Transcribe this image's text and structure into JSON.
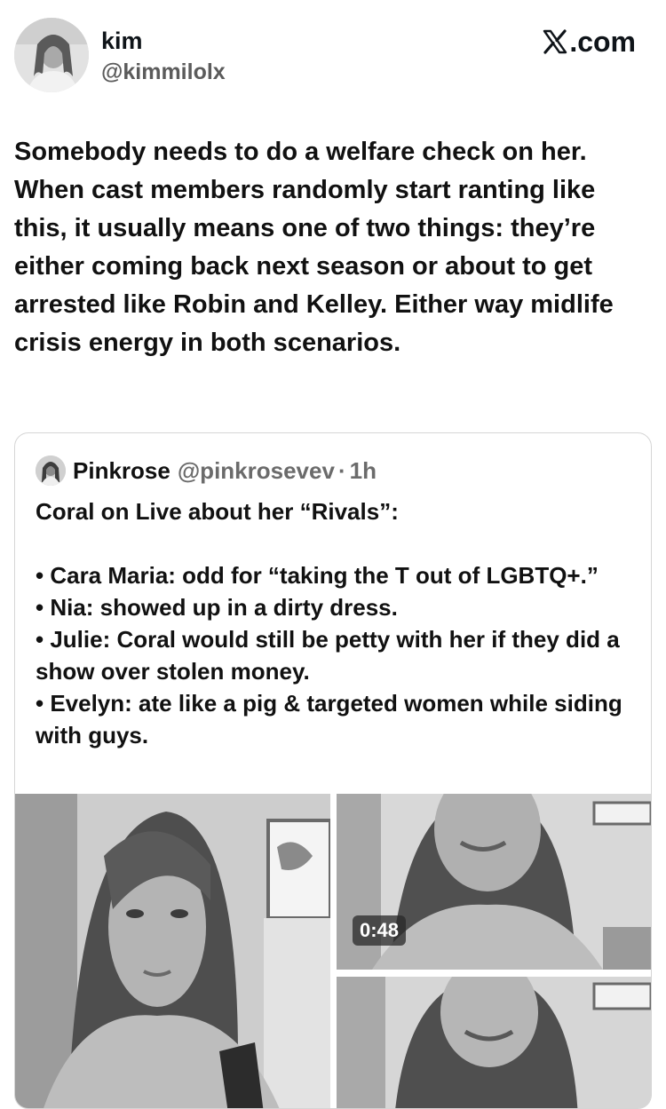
{
  "post": {
    "display_name": "kim",
    "handle": "@kimmilolx",
    "source": ".com",
    "text": "Somebody needs to do a welfare check on her. When cast members randomly start ranting like this, it usually means one of two things: they’re either coming back next season or about to get arrested like Robin and Kelley. Either way midlife crisis energy in both scenarios."
  },
  "quote": {
    "name": "Pinkrose",
    "handle": "@pinkrosevev",
    "dot": "·",
    "time": "1h",
    "lines": {
      "intro": "Coral on Live about her “Rivals”:",
      "b1": "• Cara Maria: odd for “taking the T out of LGBTQ+.”",
      "b2": "• Nia: showed up in a dirty dress.",
      "b3": "• Julie: Coral would still be petty with her if they did a show over stolen money.",
      "b4": "• Evelyn: ate like a pig & targeted women while siding with guys."
    },
    "video_duration": "0:48"
  },
  "icons": {
    "x_logo": "x-logo-icon",
    "avatar": "profile-avatar"
  }
}
